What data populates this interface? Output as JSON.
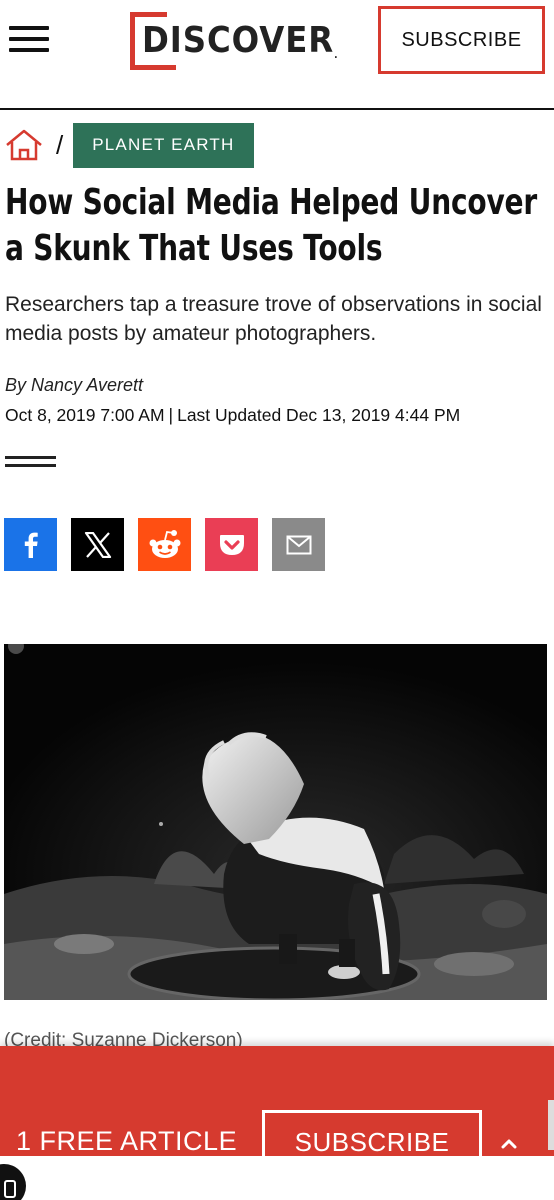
{
  "header": {
    "logo_text": "DISCOVER",
    "subscribe_label": "SUBSCRIBE",
    "accent_color": "#d63a2f"
  },
  "breadcrumb": {
    "home_icon": "home-icon",
    "separator": "/",
    "category": "PLANET EARTH",
    "category_color": "#2e7258"
  },
  "article": {
    "title": "How Social Media Helped Uncover a Skunk That Uses Tools",
    "deck": "Researchers tap a treasure trove of observations in social media posts by amateur photographers.",
    "byline": "By Nancy Averett",
    "published": "Oct 8, 2019 7:00 AM",
    "separator": "|",
    "updated": "Last Updated Dec 13, 2019 4:44 PM",
    "image_credit": "(Credit: Suzanne Dickerson)"
  },
  "share": {
    "buttons": [
      {
        "icon": "facebook-icon",
        "color": "#1a73e8"
      },
      {
        "icon": "x-icon",
        "color": "#000000"
      },
      {
        "icon": "reddit-icon",
        "color": "#ff4f12"
      },
      {
        "icon": "pocket-icon",
        "color": "#ea3e55"
      },
      {
        "icon": "email-icon",
        "color": "#8a8a8a"
      }
    ]
  },
  "paywall": {
    "free_label": "1 FREE ARTICLE",
    "subscribe_label": "SUBSCRIBE",
    "expand_icon": "chevron-up-icon"
  }
}
